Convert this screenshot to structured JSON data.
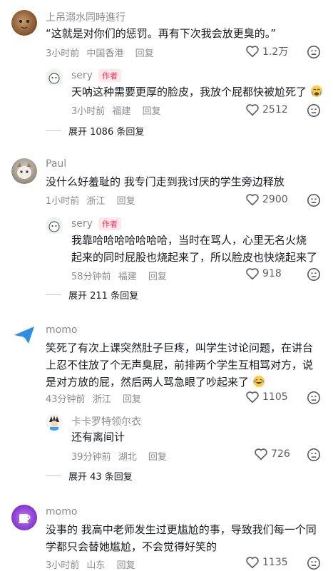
{
  "comments": [
    {
      "user": "上吊溺水同時進行",
      "text": "“这就是对你们的惩罚。再有下次我会放更臭的。”",
      "time": "3小时前",
      "location": "中国香港",
      "reply_label": "回复",
      "likes": "1.2万",
      "replies": [
        {
          "user": "sery",
          "badge": "作者",
          "text": "天呐这种需要更厚的脸皮，我放个屁都快被尬死了",
          "emoji": "crying-face",
          "time": "3小时前",
          "location": "福建",
          "reply_label": "回复",
          "likes": "2512"
        }
      ],
      "expand": "展开 1086 条回复"
    },
    {
      "user": "Paul",
      "text": "没什么好羞耻的 我专门走到我讨厌的学生旁边释放",
      "time": "1小时前",
      "location": "浙江",
      "reply_label": "回复",
      "likes": "2900",
      "replies": [
        {
          "user": "sery",
          "badge": "作者",
          "text_line1": "我靠哈哈哈哈哈哈哈，当时在骂人，心里无名火烧",
          "text_line2": "起来的同时屁股也烧起来了，所以脸皮也快烧起来了",
          "time": "58分钟前",
          "location": "福建",
          "reply_label": "回复",
          "likes": "918"
        }
      ],
      "expand": "展开 211 条回复"
    },
    {
      "user": "momo",
      "text_line1": "笑死了有次上课突然肚子巨疼，叫学生讨论问题，在讲台",
      "text_line2": "上忍不住放了个无声臭屁，前排两个学生互相骂对方，说",
      "text_line3": "是对方放的屁，然后两人骂急眼了吵起来了",
      "emoji": "laughing-face",
      "time": "43分钟前",
      "location": "浙江",
      "reply_label": "回复",
      "likes": "1105",
      "replies": [
        {
          "user": "卡卡罗特领尔衣",
          "text": "还有离间计",
          "time": "39分钟前",
          "location": "湖北",
          "reply_label": "回复",
          "likes": "726"
        }
      ],
      "expand": "展开 43 条回复"
    },
    {
      "user": "momo",
      "text_line1": "没事的 我高中老师发生过更尴尬的事，导致我们每一个同",
      "text_line2": "学都只会替她尴尬，不会觉得好笑的",
      "time": "3小时前",
      "location": "山东",
      "reply_label": "回复",
      "likes": "1135"
    }
  ]
}
